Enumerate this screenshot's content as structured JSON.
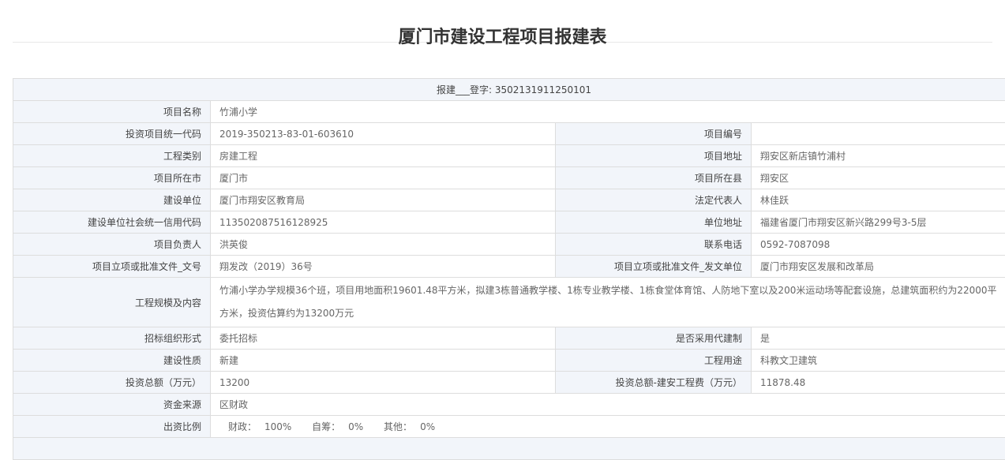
{
  "title": "厦门市建设工程项目报建表",
  "reg": "报建___登字: 3502131911250101",
  "rows": {
    "name": {
      "label": "项目名称",
      "value": "竹浦小学"
    },
    "code": {
      "label": "投资项目统一代码",
      "value": "2019-350213-83-01-603610",
      "label2": "项目编号",
      "value2": ""
    },
    "type": {
      "label": "工程类别",
      "value": "房建工程",
      "label2": "项目地址",
      "value2": "翔安区新店镇竹浦村"
    },
    "city": {
      "label": "项目所在市",
      "value": "厦门市",
      "label2": "项目所在县",
      "value2": "翔安区"
    },
    "unit": {
      "label": "建设单位",
      "value": "厦门市翔安区教育局",
      "label2": "法定代表人",
      "value2": "林佳跃"
    },
    "credit": {
      "label": "建设单位社会统一信用代码",
      "value": "113502087516128925",
      "label2": "单位地址",
      "value2": "福建省厦门市翔安区新兴路299号3-5层"
    },
    "lead": {
      "label": "项目负责人",
      "value": "洪英俊",
      "label2": "联系电话",
      "value2": "0592-7087098"
    },
    "doc": {
      "label": "项目立项或批准文件_文号",
      "value": "翔发改（2019）36号",
      "label2": "项目立项或批准文件_发文单位",
      "value2": "厦门市翔安区发展和改革局"
    },
    "scale": {
      "label": "工程规模及内容",
      "value": "竹浦小学办学规模36个班，项目用地面积19601.48平方米，拟建3栋普通教学楼、1栋专业教学楼、1栋食堂体育馆、人防地下室以及200米运动场等配套设施，总建筑面积约为22000平方米，投资估算约为13200万元"
    },
    "bid": {
      "label": "招标组织形式",
      "value": "委托招标",
      "label2": "是否采用代建制",
      "value2": "是"
    },
    "nature": {
      "label": "建设性质",
      "value": "新建",
      "label2": "工程用途",
      "value2": "科教文卫建筑"
    },
    "invest": {
      "label": "投资总额（万元）",
      "value": "13200",
      "label2": "投资总额-建安工程费（万元）",
      "value2": "11878.48"
    },
    "fund": {
      "label": "资金来源",
      "value": "区财政"
    },
    "ratio": {
      "label": "出资比例",
      "items": [
        {
          "k": "财政：",
          "v": "100%"
        },
        {
          "k": "自筹：",
          "v": "0%"
        },
        {
          "k": "其他：",
          "v": "0%"
        }
      ]
    }
  }
}
